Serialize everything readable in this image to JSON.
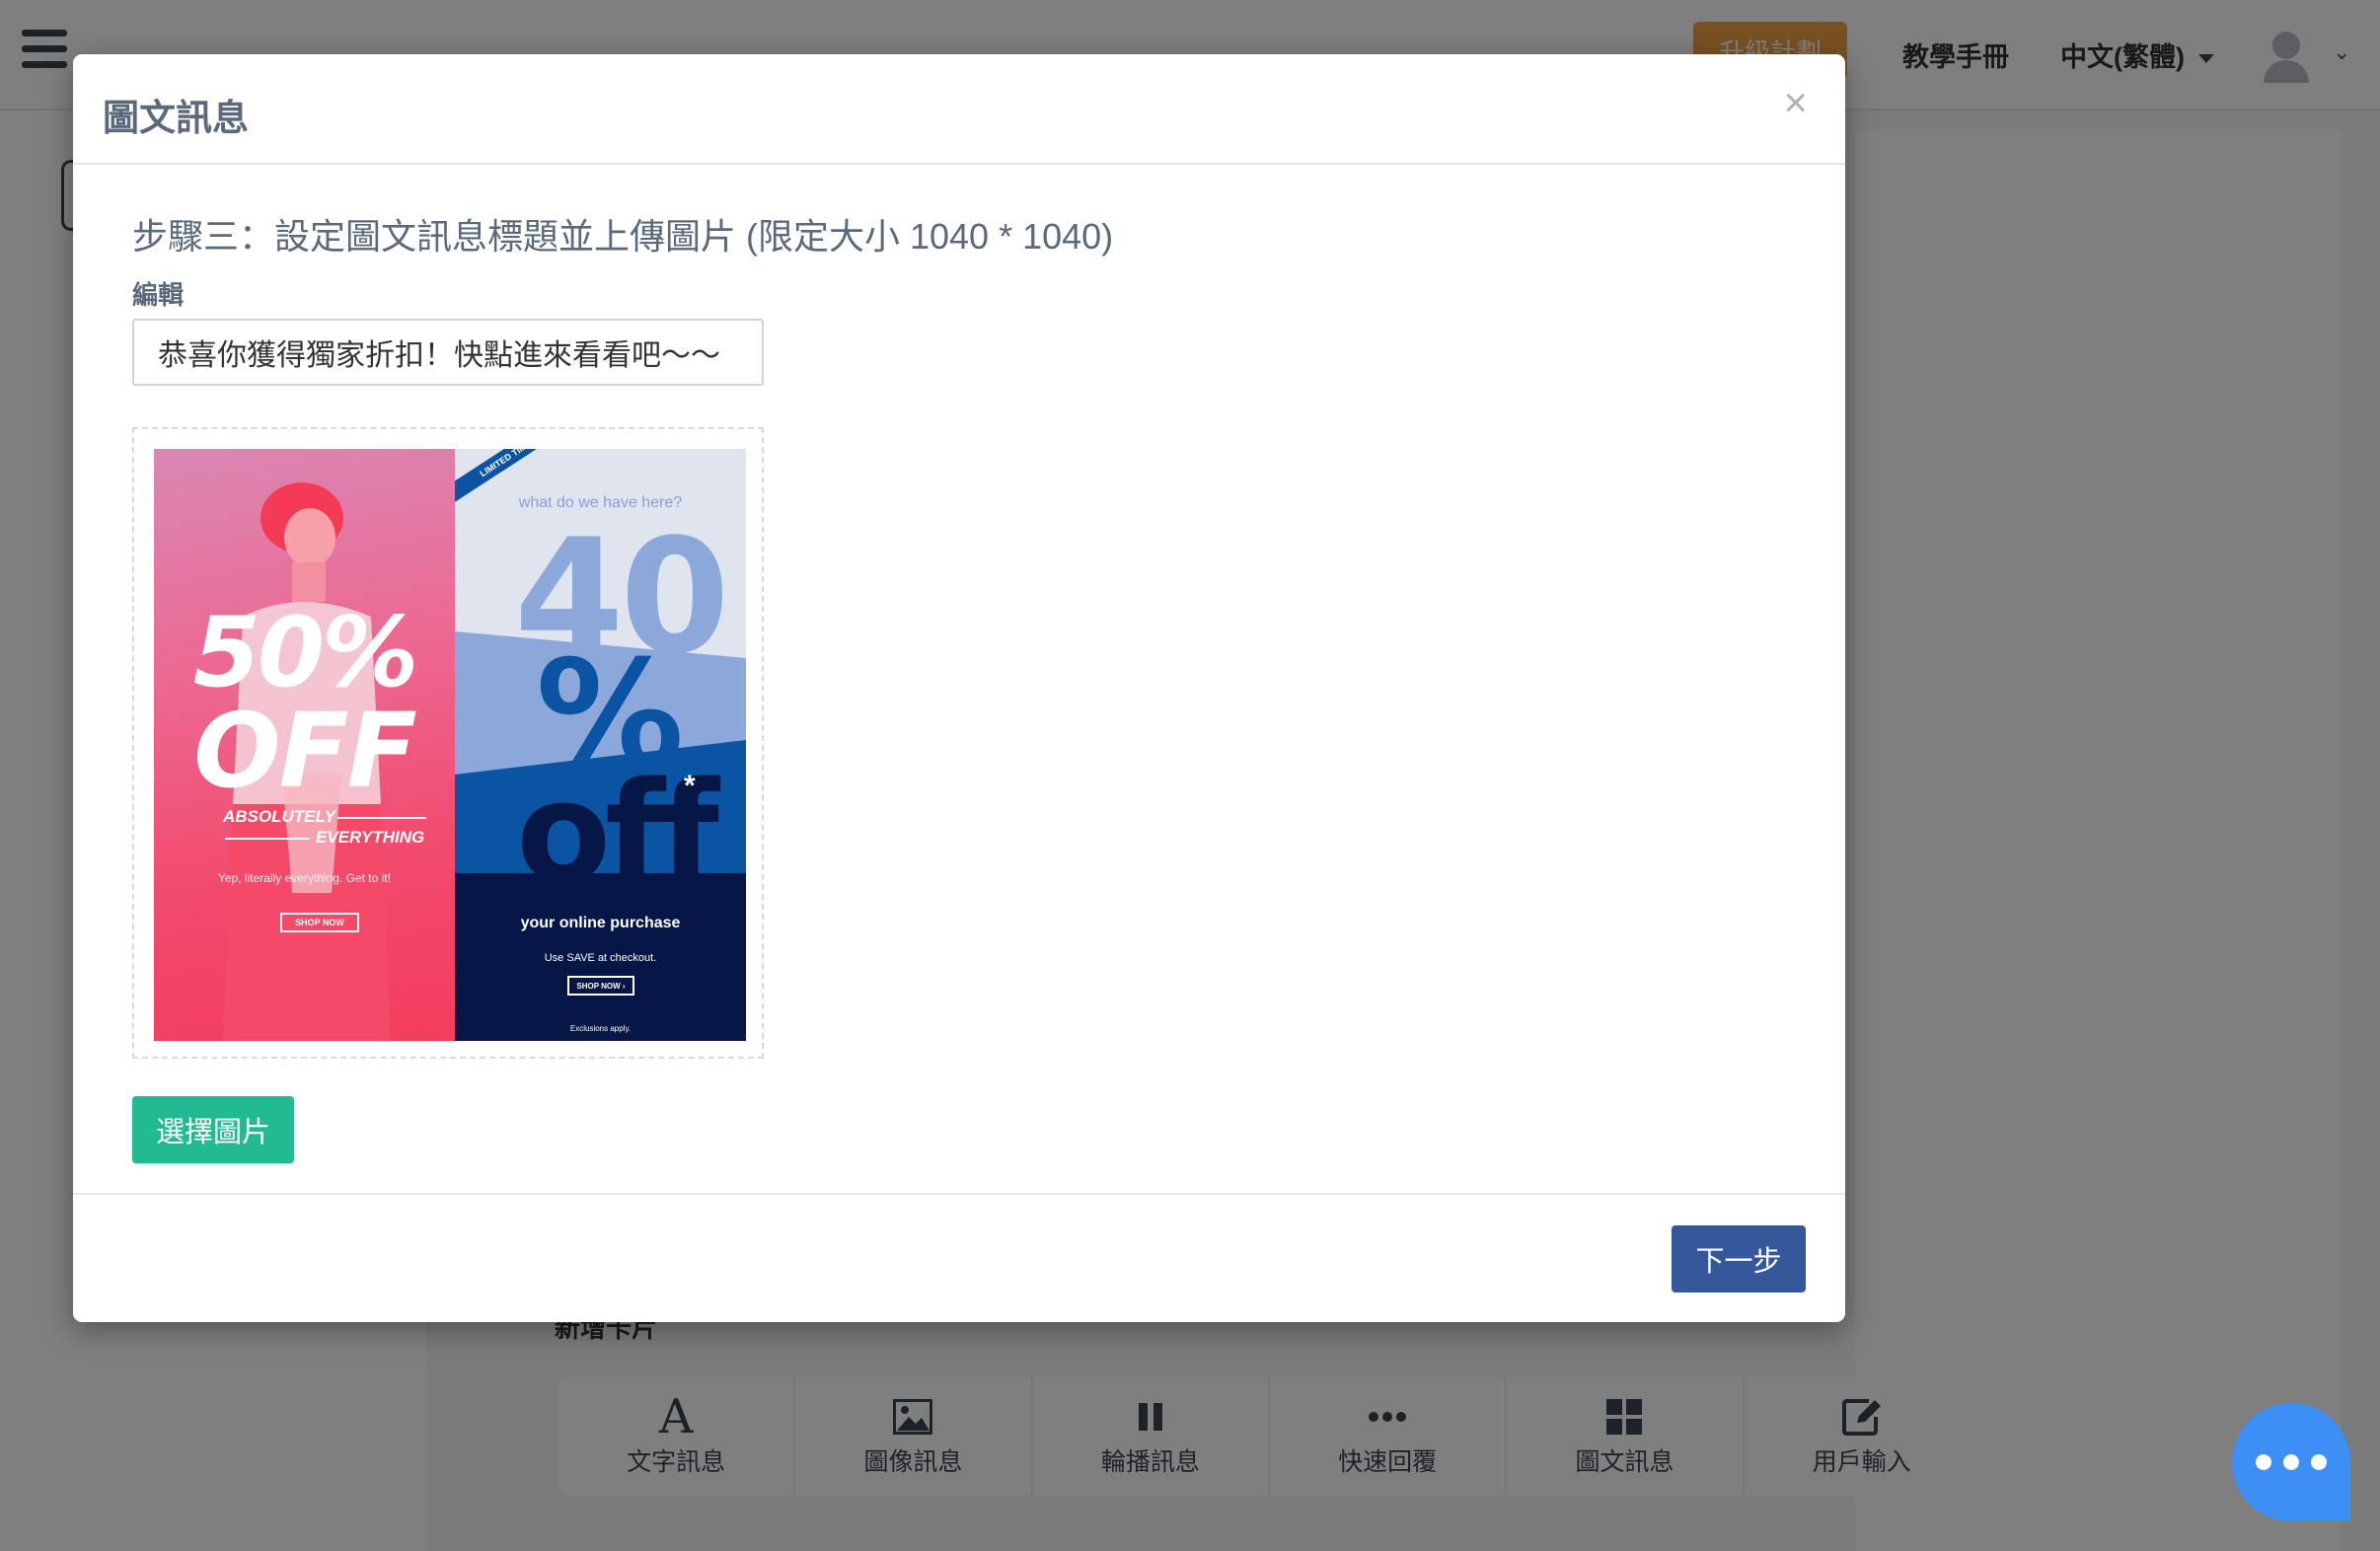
{
  "header": {
    "upgrade_label": "升級計劃",
    "tutorial_label": "教學手冊",
    "language_label": "中文(繁體)"
  },
  "content": {
    "add_card_label": "新增卡片"
  },
  "message_types": [
    {
      "icon": "letter-a-icon",
      "label": "文字訊息"
    },
    {
      "icon": "image-icon",
      "label": "圖像訊息"
    },
    {
      "icon": "pause-bars-icon",
      "label": "輪播訊息"
    },
    {
      "icon": "ellipsis-icon",
      "label": "快速回覆"
    },
    {
      "icon": "grid-icon",
      "label": "圖文訊息"
    },
    {
      "icon": "edit-icon",
      "label": "用戶輸入"
    }
  ],
  "modal": {
    "title": "圖文訊息",
    "close_symbol": "×",
    "step_heading": "步驟三：設定圖文訊息標題並上傳圖片 (限定大小 1040 * 1040)",
    "edit_label": "編輯",
    "title_value": "恭喜你獲得獨家折扣！快點進來看看吧～～",
    "choose_image_label": "選擇圖片",
    "next_label": "下一步"
  },
  "banner": {
    "left_line1": "50%",
    "left_line2": "OFF",
    "absolutely": "ABSOLUTELY",
    "everything": "EVERYTHING",
    "yep": "Yep, literally everything. Get to it!",
    "shop_now_left": "SHOP NOW",
    "limited_time": "LIMITED TIME!",
    "what_do_we_have": "what do we have here?",
    "forty": "40",
    "percent": "%",
    "off": "off",
    "asterisk": "*",
    "online_purchase": "your online purchase",
    "use_save": "Use SAVE at checkout.",
    "shop_now_right": "SHOP NOW ›",
    "exclusions": "Exclusions apply."
  },
  "colors": {
    "primary": "#35589a",
    "success": "#21ba93",
    "upgrade": "#f0a244",
    "chat": "#3b8ff5"
  }
}
